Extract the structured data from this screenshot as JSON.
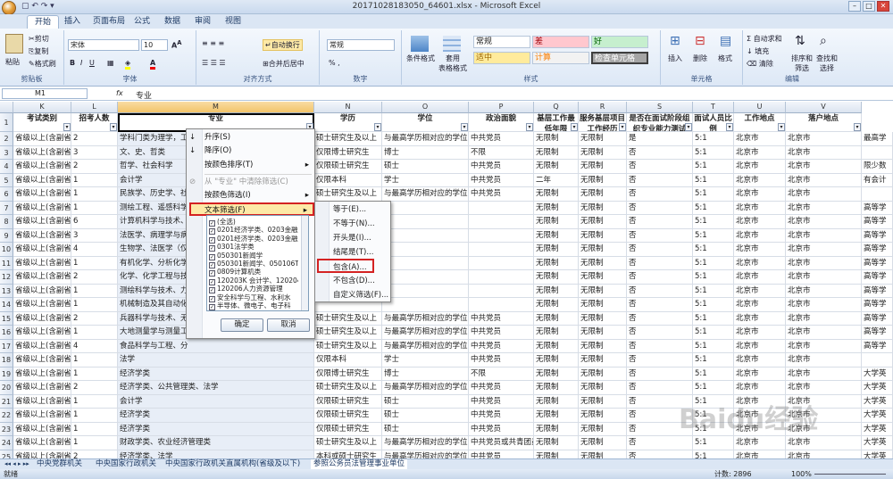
{
  "window": {
    "title": "20171028183050_64601.xlsx - Microsoft Excel",
    "btn_min": "–",
    "btn_max": "□",
    "btn_close": "✕"
  },
  "quick_access": "▢ ↶ ↷ ▾",
  "tabs": [
    "开始",
    "插入",
    "页面布局",
    "公式",
    "数据",
    "审阅",
    "视图"
  ],
  "ribbon": {
    "clipboard": {
      "paste": "粘贴",
      "cut": "剪切",
      "copy": "复制",
      "painter": "格式刷",
      "label": "剪贴板"
    },
    "font": {
      "name": "宋体",
      "size": "10",
      "label": "字体"
    },
    "align": {
      "wrap": "自动换行",
      "merge": "合并后居中",
      "label": "对齐方式"
    },
    "number": {
      "format": "常规",
      "percent": "% ,",
      "label": "数字"
    },
    "styles": {
      "cond": "条件格式",
      "table": "套用\n表格格式",
      "cell": "单元格\n样式",
      "normal": "常规",
      "bad": "差",
      "good": "好",
      "neutral": "适中",
      "calc": "计算",
      "check": "检查单元格",
      "label": "样式"
    },
    "cells": {
      "insert": "插入",
      "delete": "删除",
      "format": "格式",
      "label": "单元格"
    },
    "edit": {
      "sum": "自动求和",
      "fill": "填充",
      "clear": "清除",
      "sort": "排序和\n筛选",
      "find": "查找和\n选择",
      "label": "编辑"
    }
  },
  "formula_bar": {
    "name": "M1",
    "fx": "fx",
    "value": "专业"
  },
  "columns": [
    "K",
    "L",
    "M",
    "N",
    "O",
    "P",
    "Q",
    "R",
    "S",
    "T",
    "U",
    "V"
  ],
  "headers": [
    "考试类别",
    "招考人数",
    "专业",
    "学历",
    "学位",
    "政治面貌",
    "基层工作最低年限",
    "服务基层项目工作经历",
    "是否在面试阶段组织专业能力测试",
    "面试人员比例",
    "工作地点",
    "落户地点"
  ],
  "rows": [
    [
      "省级以上(含副省级)",
      "2",
      "学科门类为理学，工",
      "硕士研究生及以上",
      "与最高学历相对应的学位",
      "中共党员",
      "无限制",
      "无限制",
      "是",
      "5:1",
      "北京市",
      "北京市",
      "最高学"
    ],
    [
      "省级以上(含副省级)",
      "3",
      "文、史、哲类",
      "仅限博士研究生",
      "博士",
      "不限",
      "无限制",
      "无限制",
      "否",
      "5:1",
      "北京市",
      "北京市",
      ""
    ],
    [
      "省级以上(含副省级)",
      "2",
      "哲学、社会科学",
      "仅限硕士研究生",
      "硕士",
      "中共党员",
      "无限制",
      "无限制",
      "否",
      "5:1",
      "北京市",
      "北京市",
      "限少数"
    ],
    [
      "省级以上(含副省级)",
      "1",
      "会计学",
      "仅限本科",
      "学士",
      "中共党员",
      "二年",
      "无限制",
      "否",
      "5:1",
      "北京市",
      "北京市",
      "有会计"
    ],
    [
      "省级以上(含副省级)",
      "1",
      "民族学、历史学、社",
      "硕士研究生及以上",
      "与最高学历相对应的学位",
      "中共党员",
      "无限制",
      "无限制",
      "否",
      "5:1",
      "北京市",
      "北京市",
      ""
    ],
    [
      "省级以上(含副省级)",
      "1",
      "测绘工程、遥感科学",
      "",
      "",
      "",
      "无限制",
      "无限制",
      "否",
      "5:1",
      "北京市",
      "北京市",
      "高等学"
    ],
    [
      "省级以上(含副省级)",
      "6",
      "计算机科学与技术、",
      "",
      "",
      "",
      "无限制",
      "无限制",
      "否",
      "5:1",
      "北京市",
      "北京市",
      "高等学"
    ],
    [
      "省级以上(含副省级)",
      "3",
      "法医学、病理学与病",
      "",
      "",
      "",
      "无限制",
      "无限制",
      "否",
      "5:1",
      "北京市",
      "北京市",
      "高等学"
    ],
    [
      "省级以上(含副省级)",
      "4",
      "生物学、法医学（仅",
      "",
      "",
      "",
      "无限制",
      "无限制",
      "否",
      "5:1",
      "北京市",
      "北京市",
      "高等学"
    ],
    [
      "省级以上(含副省级)",
      "1",
      "有机化学、分析化学",
      "",
      "",
      "",
      "无限制",
      "无限制",
      "否",
      "5:1",
      "北京市",
      "北京市",
      "高等学"
    ],
    [
      "省级以上(含副省级)",
      "2",
      "化学、化学工程与技",
      "",
      "",
      "",
      "无限制",
      "无限制",
      "否",
      "5:1",
      "北京市",
      "北京市",
      "高等学"
    ],
    [
      "省级以上(含副省级)",
      "1",
      "测绘科学与技术、力",
      "",
      "",
      "",
      "无限制",
      "无限制",
      "否",
      "5:1",
      "北京市",
      "北京市",
      "高等学"
    ],
    [
      "省级以上(含副省级)",
      "1",
      "机械制造及其自动化",
      "",
      "",
      "",
      "无限制",
      "无限制",
      "否",
      "5:1",
      "北京市",
      "北京市",
      "高等学"
    ],
    [
      "省级以上(含副省级)",
      "2",
      "兵器科学与技术、无",
      "硕士研究生及以上",
      "与最高学历相对应的学位",
      "中共党员",
      "无限制",
      "无限制",
      "否",
      "5:1",
      "北京市",
      "北京市",
      "高等学"
    ],
    [
      "省级以上(含副省级)",
      "1",
      "大地测量学与测量工",
      "硕士研究生及以上",
      "与最高学历相对应的学位",
      "中共党员",
      "无限制",
      "无限制",
      "否",
      "5:1",
      "北京市",
      "北京市",
      "高等学"
    ],
    [
      "省级以上(含副省级)",
      "4",
      "食品科学与工程、分",
      "硕士研究生及以上",
      "与最高学历相对应的学位",
      "中共党员",
      "无限制",
      "无限制",
      "否",
      "5:1",
      "北京市",
      "北京市",
      "高等学"
    ],
    [
      "省级以上(含副省级)",
      "1",
      "法学",
      "仅限本科",
      "学士",
      "中共党员",
      "无限制",
      "无限制",
      "否",
      "5:1",
      "北京市",
      "北京市",
      ""
    ],
    [
      "省级以上(含副省级)",
      "1",
      "经济学类",
      "仅限博士研究生",
      "博士",
      "不限",
      "无限制",
      "无限制",
      "否",
      "5:1",
      "北京市",
      "北京市",
      "大学英"
    ],
    [
      "省级以上(含副省级)",
      "2",
      "经济学类、公共管理类、法学",
      "硕士研究生及以上",
      "与最高学历相对应的学位",
      "中共党员",
      "无限制",
      "无限制",
      "否",
      "5:1",
      "北京市",
      "北京市",
      "大学英"
    ],
    [
      "省级以上(含副省级)",
      "1",
      "会计学",
      "仅限硕士研究生",
      "硕士",
      "中共党员",
      "无限制",
      "无限制",
      "否",
      "5:1",
      "北京市",
      "北京市",
      "大学英"
    ],
    [
      "省级以上(含副省级)",
      "1",
      "经济学类",
      "仅限硕士研究生",
      "硕士",
      "中共党员",
      "无限制",
      "无限制",
      "否",
      "5:1",
      "北京市",
      "北京市",
      "大学英"
    ],
    [
      "省级以上(含副省级)",
      "1",
      "经济学类",
      "仅限硕士研究生",
      "硕士",
      "中共党员",
      "无限制",
      "无限制",
      "否",
      "5:1",
      "北京市",
      "北京市",
      "大学英"
    ],
    [
      "省级以上(含副省级)",
      "1",
      "财政学类、农业经济管理类",
      "硕士研究生及以上",
      "与最高学历相对应的学位",
      "中共党员或共青团员",
      "无限制",
      "无限制",
      "否",
      "5:1",
      "北京市",
      "北京市",
      "大学英"
    ],
    [
      "省级以上(含副省级)",
      "2",
      "经济学类、法学",
      "本科或硕士研究生",
      "与最高学历相对应的学位",
      "中共党员",
      "无限制",
      "无限制",
      "否",
      "5:1",
      "北京市",
      "北京市",
      "大学英"
    ]
  ],
  "filter_menu": {
    "items": [
      "升序(S)",
      "降序(O)",
      "按颜色排序(T)",
      "从 \"专业\" 中清除筛选(C)",
      "按颜色筛选(I)",
      "文本筛选(F)"
    ],
    "check_items": [
      "(全选)",
      "0201经济学类、0203金融学",
      "0201经济学类、0203金融学",
      "0301法学类",
      "050301新闻学",
      "050301新闻学、050106T(",
      "0809计算机类",
      "120203K 会计学、120204",
      "120206人力资源管理",
      "安全科学与工程、水利水",
      "半导体、微电子、电子科"
    ],
    "ok": "确定",
    "cancel": "取消"
  },
  "text_filter_submenu": [
    "等于(E)...",
    "不等于(N)...",
    "开头是(I)...",
    "结尾是(T)...",
    "包含(A)...",
    "不包含(D)...",
    "自定义筛选(F)..."
  ],
  "sheet_tabs": [
    "中央党群机关",
    "中央国家行政机关",
    "中央国家行政机关直属机构(省级及以下)",
    "参照公务员法管理事业单位"
  ],
  "status": {
    "ready": "就绪",
    "count": "计数: 2896",
    "zoom": "100%"
  },
  "watermark": "Baidu经验",
  "colors": {
    "ribbon": "#dde8f6",
    "accent": "#d42222",
    "select": "#f2c46a"
  }
}
